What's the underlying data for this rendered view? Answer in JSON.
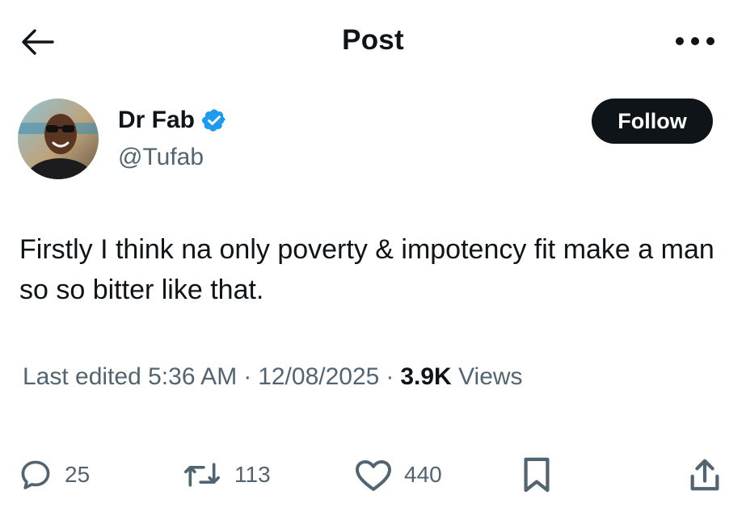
{
  "header": {
    "title": "Post",
    "back_icon": "arrow-left-icon",
    "more_icon": "more-horizontal-icon"
  },
  "author": {
    "display_name": "Dr Fab",
    "handle": "@Tufab",
    "verified": true,
    "follow_label": "Follow"
  },
  "post": {
    "text": "Firstly I think na only poverty & impotency fit make a man so so bitter like that.",
    "edited_label": "Last edited 5:36 AM",
    "date": "12/08/2025",
    "views_count": "3.9K",
    "views_label": "Views"
  },
  "actions": {
    "replies": "25",
    "reposts": "113",
    "likes": "440"
  },
  "colors": {
    "text": "#0f1419",
    "secondary": "#536471",
    "verified": "#1d9bf0",
    "follow_bg": "#0f1419"
  }
}
